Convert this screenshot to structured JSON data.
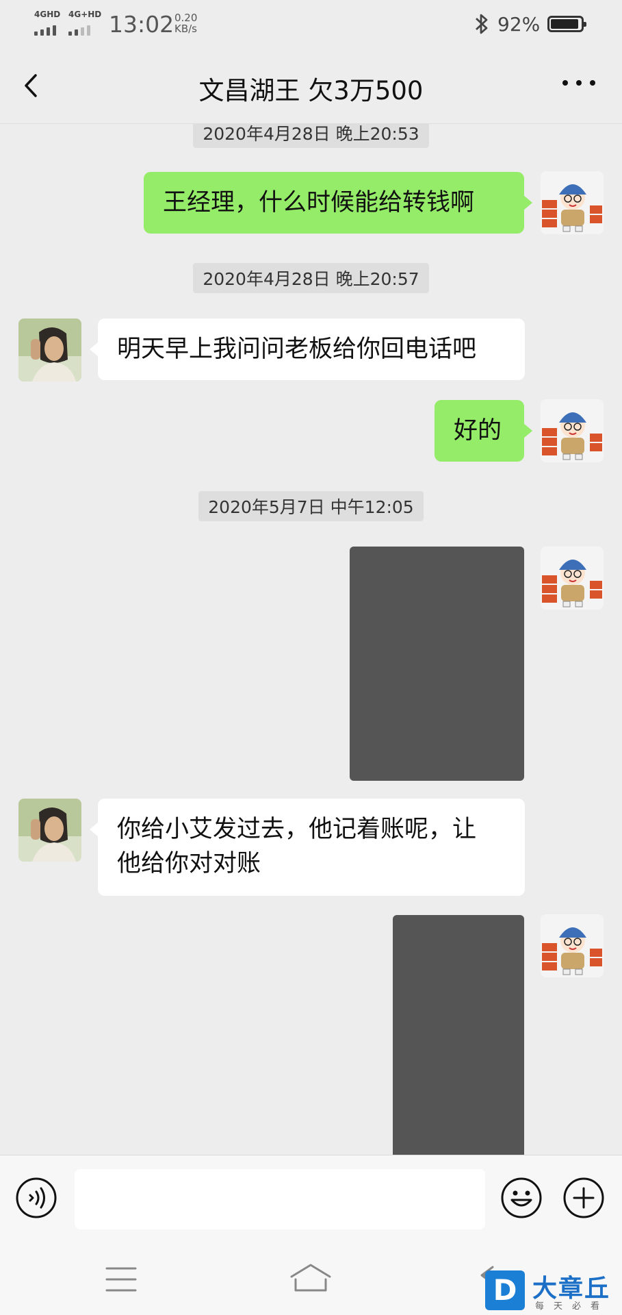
{
  "status_bar": {
    "signal1_label": "4GHD",
    "signal2_label": "4G+HD",
    "time": "13:02",
    "speed_value": "0.20",
    "speed_unit": "KB/s",
    "battery_percent": "92%",
    "battery_level": 0.92
  },
  "nav": {
    "title": "文昌湖王 欠3万500",
    "back_icon": "chevron-left-icon",
    "more_icon": "more-horizontal-icon"
  },
  "messages": [
    {
      "type": "timestamp",
      "text": "2020年4月28日 晚上20:53"
    },
    {
      "type": "text",
      "side": "right",
      "text": "王经理，什么时候能给转钱啊"
    },
    {
      "type": "timestamp",
      "text": "2020年4月28日 晚上20:57"
    },
    {
      "type": "text",
      "side": "left",
      "text": "明天早上我问问老板给你回电话吧"
    },
    {
      "type": "text",
      "side": "right",
      "text": "好的"
    },
    {
      "type": "timestamp",
      "text": "2020年5月7日 中午12:05"
    },
    {
      "type": "image",
      "side": "right",
      "content": "redacted-image"
    },
    {
      "type": "text",
      "side": "left",
      "text": "你给小艾发过去，他记着账呢，让他给你对对账",
      "lines": [
        "你给小艾发过去，他记着账呢，让",
        "他给你对对账"
      ]
    },
    {
      "type": "image",
      "side": "right",
      "content": "redacted-image"
    }
  ],
  "input_bar": {
    "voice_icon": "voice-icon",
    "text_value": "",
    "emoji_icon": "emoji-icon",
    "plus_icon": "plus-icon"
  },
  "system_nav": {
    "menu_icon": "menu-icon",
    "home_icon": "home-icon",
    "back_icon": "back-icon"
  },
  "watermark": {
    "logo_letter": "D",
    "name": "大章丘",
    "tagline": "每天必看"
  },
  "colors": {
    "chat_bg": "#ededed",
    "sent_bubble": "#95ec69",
    "received_bubble": "#ffffff",
    "redacted_image": "#555555",
    "watermark_blue": "#1b7fd6"
  }
}
